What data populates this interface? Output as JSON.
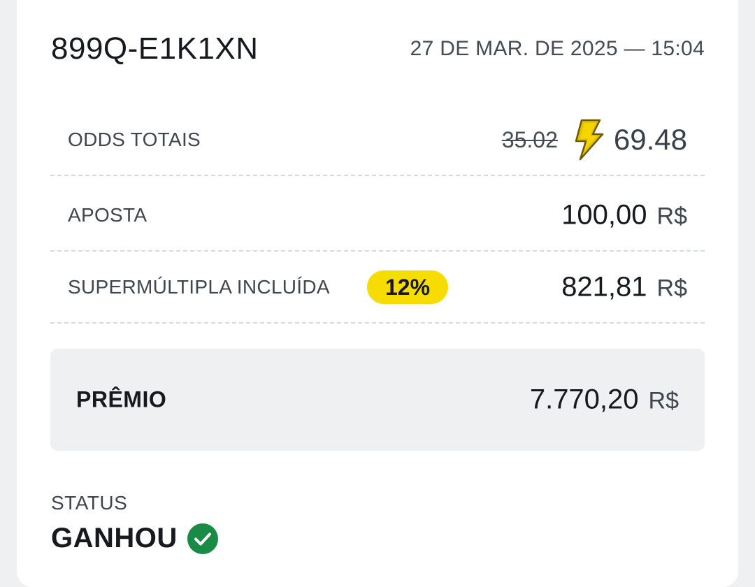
{
  "ticket": {
    "id": "899Q-E1K1XN",
    "date": "27 DE MAR. DE 2025 — 15:04"
  },
  "odds": {
    "label": "ODDS TOTAIS",
    "old_value": "35.02",
    "new_value": "69.48",
    "icon": "lightning-bolt-icon"
  },
  "stake": {
    "label": "APOSTA",
    "amount": "100,00",
    "currency": "R$"
  },
  "supermultiple": {
    "label": "SUPERMÚLTIPLA INCLUÍDA",
    "badge": "12%",
    "amount": "821,81",
    "currency": "R$"
  },
  "prize": {
    "label": "PRÊMIO",
    "amount": "7.770,20",
    "currency": "R$"
  },
  "status": {
    "label": "STATUS",
    "value": "GANHOU",
    "icon": "check-circle-icon"
  },
  "colors": {
    "badge": "#f6dc00",
    "bolt": "#e5c300",
    "success": "#1a8a47",
    "prize_bg": "#eff0f2"
  }
}
